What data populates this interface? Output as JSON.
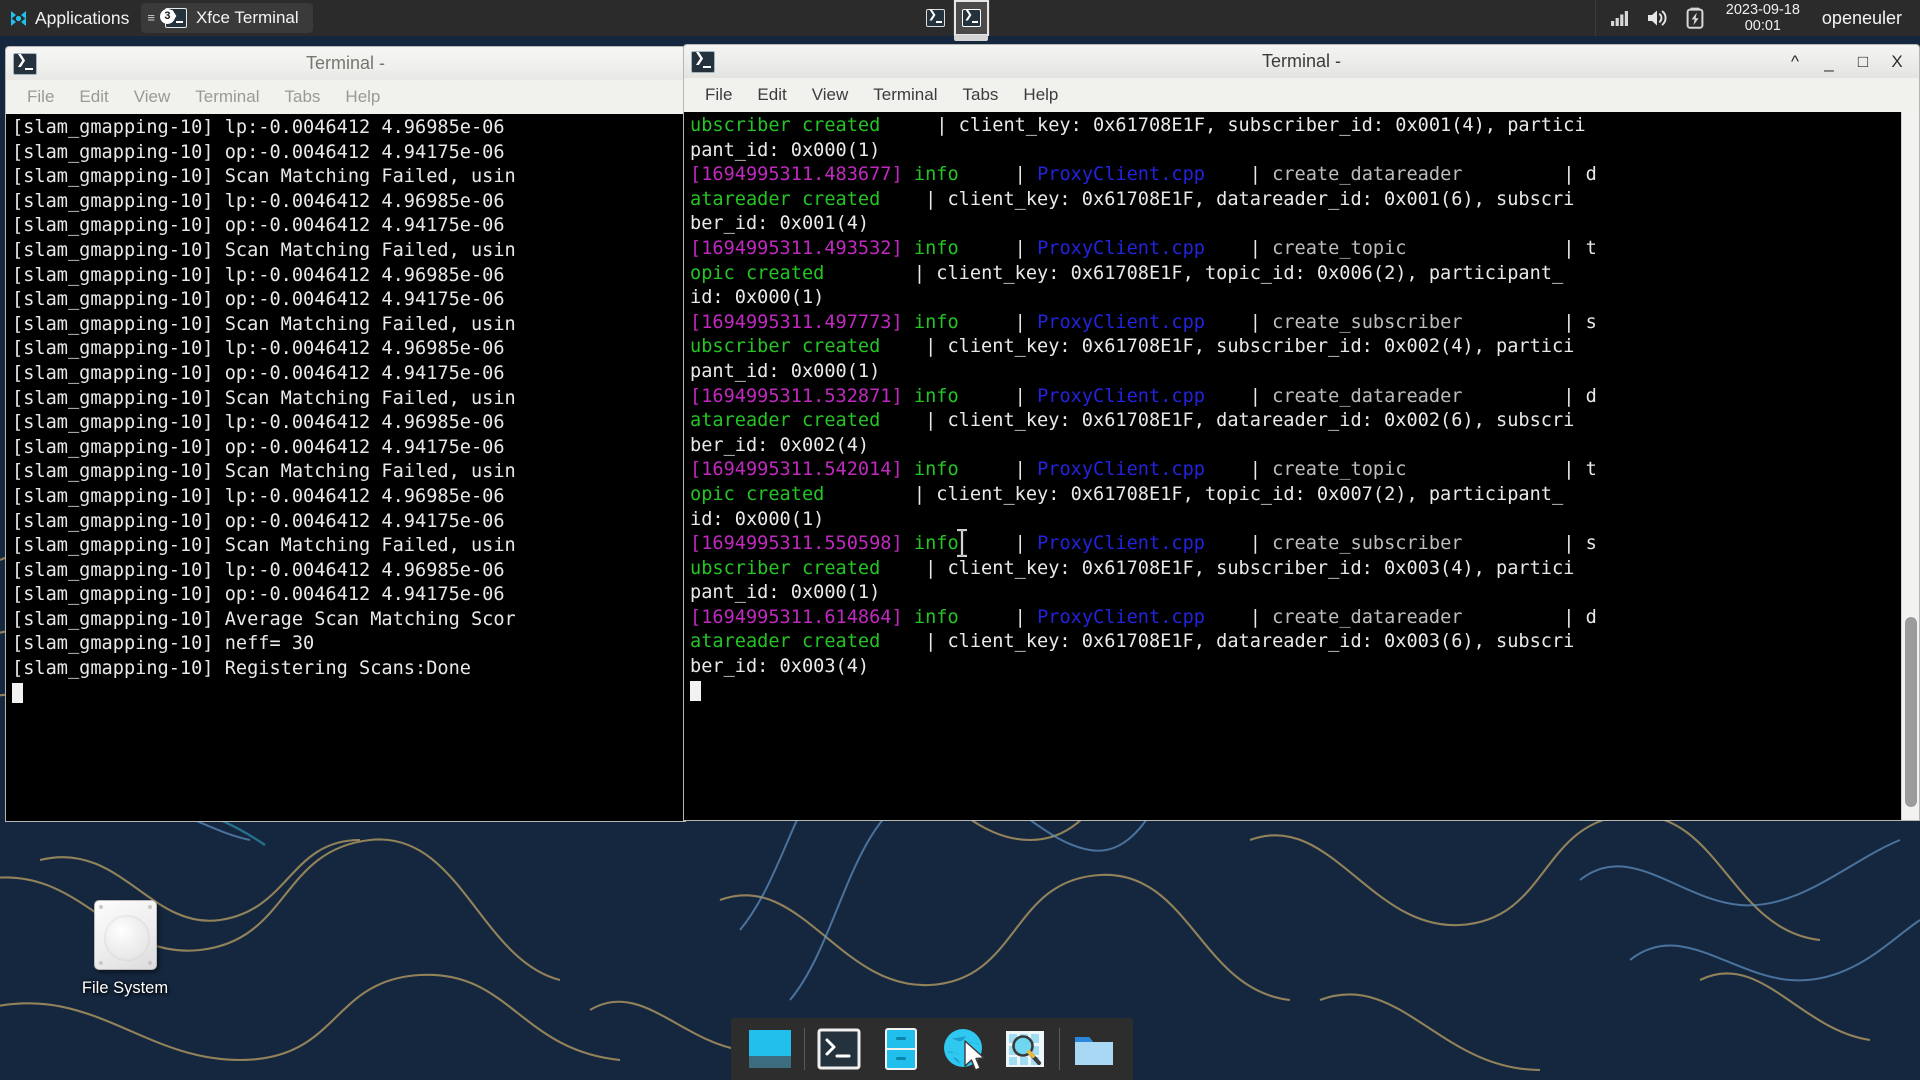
{
  "panel": {
    "applications_label": "Applications",
    "applications_icon": "xfce-mouse-logo-icon",
    "task_button": {
      "label": "Xfce Terminal",
      "icon": "terminal-icon",
      "badge": "3",
      "menu_glyph": "≡"
    },
    "workspaces": [
      {
        "name": "workspace-1",
        "icon": "terminal-mini-icon",
        "active": "false"
      },
      {
        "name": "workspace-2",
        "icon": "terminal-mini-icon",
        "active": "true"
      }
    ],
    "tray": {
      "network_icon": "signal-bars-icon",
      "volume_icon": "speaker-icon",
      "battery_icon": "battery-charging-icon"
    },
    "clock": {
      "date": "2023-09-18",
      "time": "00:01"
    },
    "user": "openeuler"
  },
  "desktop": {
    "icons": [
      {
        "label": "File System",
        "icon": "hard-disk-icon"
      }
    ]
  },
  "left_window": {
    "title": "Terminal -",
    "icon": "terminal-icon",
    "menus": [
      "File",
      "Edit",
      "View",
      "Terminal",
      "Tabs",
      "Help"
    ],
    "lines": [
      "[slam_gmapping-10] lp:-0.0046412 4.96985e-06",
      "[slam_gmapping-10] op:-0.0046412 4.94175e-06",
      "[slam_gmapping-10] Scan Matching Failed, usin",
      "[slam_gmapping-10] lp:-0.0046412 4.96985e-06",
      "[slam_gmapping-10] op:-0.0046412 4.94175e-06",
      "[slam_gmapping-10] Scan Matching Failed, usin",
      "[slam_gmapping-10] lp:-0.0046412 4.96985e-06",
      "[slam_gmapping-10] op:-0.0046412 4.94175e-06",
      "[slam_gmapping-10] Scan Matching Failed, usin",
      "[slam_gmapping-10] lp:-0.0046412 4.96985e-06",
      "[slam_gmapping-10] op:-0.0046412 4.94175e-06",
      "[slam_gmapping-10] Scan Matching Failed, usin",
      "[slam_gmapping-10] lp:-0.0046412 4.96985e-06",
      "[slam_gmapping-10] op:-0.0046412 4.94175e-06",
      "[slam_gmapping-10] Scan Matching Failed, usin",
      "[slam_gmapping-10] lp:-0.0046412 4.96985e-06",
      "[slam_gmapping-10] op:-0.0046412 4.94175e-06",
      "[slam_gmapping-10] Scan Matching Failed, usin",
      "[slam_gmapping-10] lp:-0.0046412 4.96985e-06",
      "[slam_gmapping-10] op:-0.0046412 4.94175e-06",
      "[slam_gmapping-10] Average Scan Matching Scor",
      "[slam_gmapping-10] neff= 30",
      "[slam_gmapping-10] Registering Scans:Done"
    ]
  },
  "right_window": {
    "title": "Terminal -",
    "icon": "terminal-icon",
    "menus": [
      "File",
      "Edit",
      "View",
      "Terminal",
      "Tabs",
      "Help"
    ],
    "controls": {
      "shade": "^",
      "minimize": "_",
      "maximize": "□",
      "close": "X"
    },
    "log_lines": [
      [
        {
          "t": "ubscriber created",
          "c": "green"
        },
        {
          "t": "     | client_key: 0x61708E1F, subscriber_id: 0x001(4), partici",
          "c": "white"
        }
      ],
      [
        {
          "t": "pant_id: 0x000(1)",
          "c": "white"
        }
      ],
      [
        {
          "t": "[1694995311.483677]",
          "c": "magenta"
        },
        {
          "t": " ",
          "c": "white"
        },
        {
          "t": "info",
          "c": "green"
        },
        {
          "t": "     | ",
          "c": "white"
        },
        {
          "t": "ProxyClient.cpp",
          "c": "blue"
        },
        {
          "t": "    | ",
          "c": "white"
        },
        {
          "t": "create_datareader",
          "c": "grey"
        },
        {
          "t": "         | d",
          "c": "white"
        }
      ],
      [
        {
          "t": "atareader created",
          "c": "green"
        },
        {
          "t": "    | client_key: 0x61708E1F, datareader_id: 0x001(6), subscri",
          "c": "white"
        }
      ],
      [
        {
          "t": "ber_id: 0x001(4)",
          "c": "white"
        }
      ],
      [
        {
          "t": "[1694995311.493532]",
          "c": "magenta"
        },
        {
          "t": " ",
          "c": "white"
        },
        {
          "t": "info",
          "c": "green"
        },
        {
          "t": "     | ",
          "c": "white"
        },
        {
          "t": "ProxyClient.cpp",
          "c": "blue"
        },
        {
          "t": "    | ",
          "c": "white"
        },
        {
          "t": "create_topic",
          "c": "grey"
        },
        {
          "t": "              | t",
          "c": "white"
        }
      ],
      [
        {
          "t": "opic created",
          "c": "green"
        },
        {
          "t": "        | client_key: 0x61708E1F, topic_id: 0x006(2), participant_",
          "c": "white"
        }
      ],
      [
        {
          "t": "id: 0x000(1)",
          "c": "white"
        }
      ],
      [
        {
          "t": "[1694995311.497773]",
          "c": "magenta"
        },
        {
          "t": " ",
          "c": "white"
        },
        {
          "t": "info",
          "c": "green"
        },
        {
          "t": "     | ",
          "c": "white"
        },
        {
          "t": "ProxyClient.cpp",
          "c": "blue"
        },
        {
          "t": "    | ",
          "c": "white"
        },
        {
          "t": "create_subscriber",
          "c": "grey"
        },
        {
          "t": "         | s",
          "c": "white"
        }
      ],
      [
        {
          "t": "ubscriber created",
          "c": "green"
        },
        {
          "t": "    | client_key: 0x61708E1F, subscriber_id: 0x002(4), partici",
          "c": "white"
        }
      ],
      [
        {
          "t": "pant_id: 0x000(1)",
          "c": "white"
        }
      ],
      [
        {
          "t": "[1694995311.532871]",
          "c": "magenta"
        },
        {
          "t": " ",
          "c": "white"
        },
        {
          "t": "info",
          "c": "green"
        },
        {
          "t": "     | ",
          "c": "white"
        },
        {
          "t": "ProxyClient.cpp",
          "c": "blue"
        },
        {
          "t": "    | ",
          "c": "white"
        },
        {
          "t": "create_datareader",
          "c": "grey"
        },
        {
          "t": "         | d",
          "c": "white"
        }
      ],
      [
        {
          "t": "atareader created",
          "c": "green"
        },
        {
          "t": "    | client_key: 0x61708E1F, datareader_id: 0x002(6), subscri",
          "c": "white"
        }
      ],
      [
        {
          "t": "ber_id: 0x002(4)",
          "c": "white"
        }
      ],
      [
        {
          "t": "[1694995311.542014]",
          "c": "magenta"
        },
        {
          "t": " ",
          "c": "white"
        },
        {
          "t": "info",
          "c": "green"
        },
        {
          "t": "     | ",
          "c": "white"
        },
        {
          "t": "ProxyClient.cpp",
          "c": "blue"
        },
        {
          "t": "    | ",
          "c": "white"
        },
        {
          "t": "create_topic",
          "c": "grey"
        },
        {
          "t": "              | t",
          "c": "white"
        }
      ],
      [
        {
          "t": "opic created",
          "c": "green"
        },
        {
          "t": "        | client_key: 0x61708E1F, topic_id: 0x007(2), participant_",
          "c": "white"
        }
      ],
      [
        {
          "t": "id: 0x000(1)",
          "c": "white"
        }
      ],
      [
        {
          "t": "[1694995311.550598]",
          "c": "magenta"
        },
        {
          "t": " ",
          "c": "white"
        },
        {
          "t": "info",
          "c": "green"
        },
        {
          "t": "     | ",
          "c": "white"
        },
        {
          "t": "ProxyClient.cpp",
          "c": "blue"
        },
        {
          "t": "    | ",
          "c": "white"
        },
        {
          "t": "create_subscriber",
          "c": "grey"
        },
        {
          "t": "         | s",
          "c": "white"
        }
      ],
      [
        {
          "t": "ubscriber created",
          "c": "green"
        },
        {
          "t": "    | client_key: 0x61708E1F, subscriber_id: 0x003(4), partici",
          "c": "white"
        }
      ],
      [
        {
          "t": "pant_id: 0x000(1)",
          "c": "white"
        }
      ],
      [
        {
          "t": "[1694995311.614864]",
          "c": "magenta"
        },
        {
          "t": " ",
          "c": "white"
        },
        {
          "t": "info",
          "c": "green"
        },
        {
          "t": "     | ",
          "c": "white"
        },
        {
          "t": "ProxyClient.cpp",
          "c": "blue"
        },
        {
          "t": "    | ",
          "c": "white"
        },
        {
          "t": "create_datareader",
          "c": "grey"
        },
        {
          "t": "         | d",
          "c": "white"
        }
      ],
      [
        {
          "t": "atareader created",
          "c": "green"
        },
        {
          "t": "    | client_key: 0x61708E1F, datareader_id: 0x003(6), subscri",
          "c": "white"
        }
      ],
      [
        {
          "t": "ber_id: 0x003(4)",
          "c": "white"
        }
      ]
    ]
  },
  "dock": {
    "items": [
      {
        "name": "show-desktop-icon",
        "label": "Show Desktop"
      },
      {
        "name": "terminal-icon",
        "label": "Terminal"
      },
      {
        "name": "file-cabinet-icon",
        "label": "Archive Manager"
      },
      {
        "name": "web-browser-icon",
        "label": "Web Browser"
      },
      {
        "name": "app-finder-icon",
        "label": "Application Finder"
      },
      {
        "name": "file-manager-icon",
        "label": "File Manager"
      }
    ]
  },
  "colors": {
    "panel_bg": "#2b2b2b",
    "desktop_bg": "#15273f",
    "contour_tan": "#b09a6a",
    "contour_blue": "#5f93c4",
    "term_green": "#25c425",
    "term_magenta": "#c028c0",
    "term_blue": "#2323dd",
    "dock_bg": "#2d2d2d",
    "accent_cyan": "#21c0ec"
  }
}
